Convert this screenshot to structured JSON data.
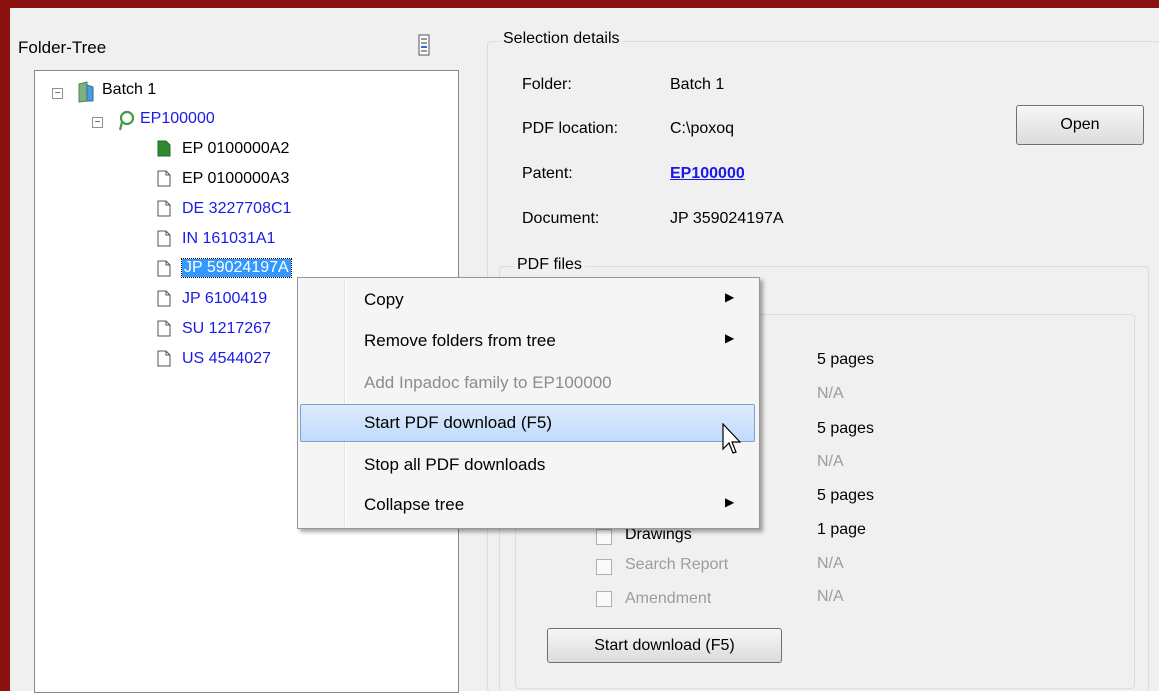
{
  "folder_tree": {
    "title": "Folder-Tree",
    "root": "Batch 1",
    "patent": "EP100000",
    "documents": [
      {
        "label": "EP 0100000A2",
        "color": "black",
        "icon": "green-doc-icon"
      },
      {
        "label": "EP 0100000A3",
        "color": "black",
        "icon": "doc-icon"
      },
      {
        "label": "DE 3227708C1",
        "color": "blue",
        "icon": "doc-icon"
      },
      {
        "label": "IN 161031A1",
        "color": "blue",
        "icon": "doc-icon"
      },
      {
        "label": "JP 59024197A",
        "color": "selected",
        "icon": "doc-icon"
      },
      {
        "label": "JP 6100419",
        "color": "blue",
        "icon": "doc-icon"
      },
      {
        "label": "SU 1217267",
        "color": "blue",
        "icon": "doc-icon"
      },
      {
        "label": "US 4544027",
        "color": "blue",
        "icon": "doc-icon"
      }
    ]
  },
  "selection_details": {
    "title": "Selection details",
    "folder_label": "Folder:",
    "folder_value": "Batch 1",
    "pdf_location_label": "PDF location:",
    "pdf_location_value": "C:\\poxoq",
    "open_button": "Open",
    "patent_label": "Patent:",
    "patent_value": "EP100000",
    "document_label": "Document:",
    "document_value": "JP 359024197A"
  },
  "pdf_files": {
    "title": "PDF files",
    "pages": [
      "5 pages",
      "N/A",
      "5 pages",
      "N/A",
      "5 pages"
    ],
    "rows": [
      {
        "label": "Drawings",
        "value": "1 page",
        "enabled": true
      },
      {
        "label": "Search Report",
        "value": "N/A",
        "enabled": false
      },
      {
        "label": "Amendment",
        "value": "N/A",
        "enabled": false
      }
    ],
    "start_download_button": "Start download (F5)"
  },
  "context_menu": {
    "items": [
      {
        "label": "Copy",
        "submenu": true,
        "enabled": true
      },
      {
        "label": "Remove folders from tree",
        "submenu": true,
        "enabled": true
      },
      {
        "label": "Add Inpadoc family to EP100000",
        "submenu": false,
        "enabled": false
      },
      {
        "label": "Start PDF download (F5)",
        "submenu": false,
        "enabled": true,
        "highlighted": true
      },
      {
        "label": "Stop all PDF downloads",
        "submenu": false,
        "enabled": true
      },
      {
        "label": "Collapse tree",
        "submenu": true,
        "enabled": true
      }
    ]
  }
}
